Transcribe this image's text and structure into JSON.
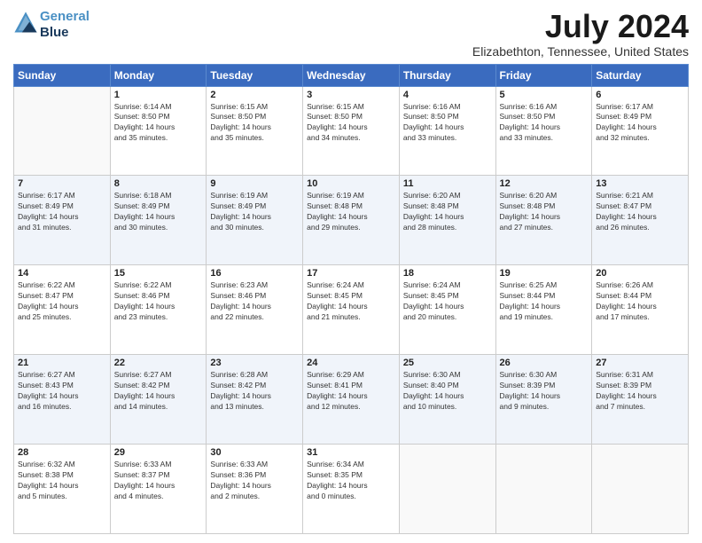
{
  "header": {
    "logo_line1": "General",
    "logo_line2": "Blue",
    "month": "July 2024",
    "location": "Elizabethton, Tennessee, United States"
  },
  "weekdays": [
    "Sunday",
    "Monday",
    "Tuesday",
    "Wednesday",
    "Thursday",
    "Friday",
    "Saturday"
  ],
  "weeks": [
    [
      {
        "day": "",
        "info": ""
      },
      {
        "day": "1",
        "info": "Sunrise: 6:14 AM\nSunset: 8:50 PM\nDaylight: 14 hours\nand 35 minutes."
      },
      {
        "day": "2",
        "info": "Sunrise: 6:15 AM\nSunset: 8:50 PM\nDaylight: 14 hours\nand 35 minutes."
      },
      {
        "day": "3",
        "info": "Sunrise: 6:15 AM\nSunset: 8:50 PM\nDaylight: 14 hours\nand 34 minutes."
      },
      {
        "day": "4",
        "info": "Sunrise: 6:16 AM\nSunset: 8:50 PM\nDaylight: 14 hours\nand 33 minutes."
      },
      {
        "day": "5",
        "info": "Sunrise: 6:16 AM\nSunset: 8:50 PM\nDaylight: 14 hours\nand 33 minutes."
      },
      {
        "day": "6",
        "info": "Sunrise: 6:17 AM\nSunset: 8:49 PM\nDaylight: 14 hours\nand 32 minutes."
      }
    ],
    [
      {
        "day": "7",
        "info": "Sunrise: 6:17 AM\nSunset: 8:49 PM\nDaylight: 14 hours\nand 31 minutes."
      },
      {
        "day": "8",
        "info": "Sunrise: 6:18 AM\nSunset: 8:49 PM\nDaylight: 14 hours\nand 30 minutes."
      },
      {
        "day": "9",
        "info": "Sunrise: 6:19 AM\nSunset: 8:49 PM\nDaylight: 14 hours\nand 30 minutes."
      },
      {
        "day": "10",
        "info": "Sunrise: 6:19 AM\nSunset: 8:48 PM\nDaylight: 14 hours\nand 29 minutes."
      },
      {
        "day": "11",
        "info": "Sunrise: 6:20 AM\nSunset: 8:48 PM\nDaylight: 14 hours\nand 28 minutes."
      },
      {
        "day": "12",
        "info": "Sunrise: 6:20 AM\nSunset: 8:48 PM\nDaylight: 14 hours\nand 27 minutes."
      },
      {
        "day": "13",
        "info": "Sunrise: 6:21 AM\nSunset: 8:47 PM\nDaylight: 14 hours\nand 26 minutes."
      }
    ],
    [
      {
        "day": "14",
        "info": "Sunrise: 6:22 AM\nSunset: 8:47 PM\nDaylight: 14 hours\nand 25 minutes."
      },
      {
        "day": "15",
        "info": "Sunrise: 6:22 AM\nSunset: 8:46 PM\nDaylight: 14 hours\nand 23 minutes."
      },
      {
        "day": "16",
        "info": "Sunrise: 6:23 AM\nSunset: 8:46 PM\nDaylight: 14 hours\nand 22 minutes."
      },
      {
        "day": "17",
        "info": "Sunrise: 6:24 AM\nSunset: 8:45 PM\nDaylight: 14 hours\nand 21 minutes."
      },
      {
        "day": "18",
        "info": "Sunrise: 6:24 AM\nSunset: 8:45 PM\nDaylight: 14 hours\nand 20 minutes."
      },
      {
        "day": "19",
        "info": "Sunrise: 6:25 AM\nSunset: 8:44 PM\nDaylight: 14 hours\nand 19 minutes."
      },
      {
        "day": "20",
        "info": "Sunrise: 6:26 AM\nSunset: 8:44 PM\nDaylight: 14 hours\nand 17 minutes."
      }
    ],
    [
      {
        "day": "21",
        "info": "Sunrise: 6:27 AM\nSunset: 8:43 PM\nDaylight: 14 hours\nand 16 minutes."
      },
      {
        "day": "22",
        "info": "Sunrise: 6:27 AM\nSunset: 8:42 PM\nDaylight: 14 hours\nand 14 minutes."
      },
      {
        "day": "23",
        "info": "Sunrise: 6:28 AM\nSunset: 8:42 PM\nDaylight: 14 hours\nand 13 minutes."
      },
      {
        "day": "24",
        "info": "Sunrise: 6:29 AM\nSunset: 8:41 PM\nDaylight: 14 hours\nand 12 minutes."
      },
      {
        "day": "25",
        "info": "Sunrise: 6:30 AM\nSunset: 8:40 PM\nDaylight: 14 hours\nand 10 minutes."
      },
      {
        "day": "26",
        "info": "Sunrise: 6:30 AM\nSunset: 8:39 PM\nDaylight: 14 hours\nand 9 minutes."
      },
      {
        "day": "27",
        "info": "Sunrise: 6:31 AM\nSunset: 8:39 PM\nDaylight: 14 hours\nand 7 minutes."
      }
    ],
    [
      {
        "day": "28",
        "info": "Sunrise: 6:32 AM\nSunset: 8:38 PM\nDaylight: 14 hours\nand 5 minutes."
      },
      {
        "day": "29",
        "info": "Sunrise: 6:33 AM\nSunset: 8:37 PM\nDaylight: 14 hours\nand 4 minutes."
      },
      {
        "day": "30",
        "info": "Sunrise: 6:33 AM\nSunset: 8:36 PM\nDaylight: 14 hours\nand 2 minutes."
      },
      {
        "day": "31",
        "info": "Sunrise: 6:34 AM\nSunset: 8:35 PM\nDaylight: 14 hours\nand 0 minutes."
      },
      {
        "day": "",
        "info": ""
      },
      {
        "day": "",
        "info": ""
      },
      {
        "day": "",
        "info": ""
      }
    ]
  ]
}
